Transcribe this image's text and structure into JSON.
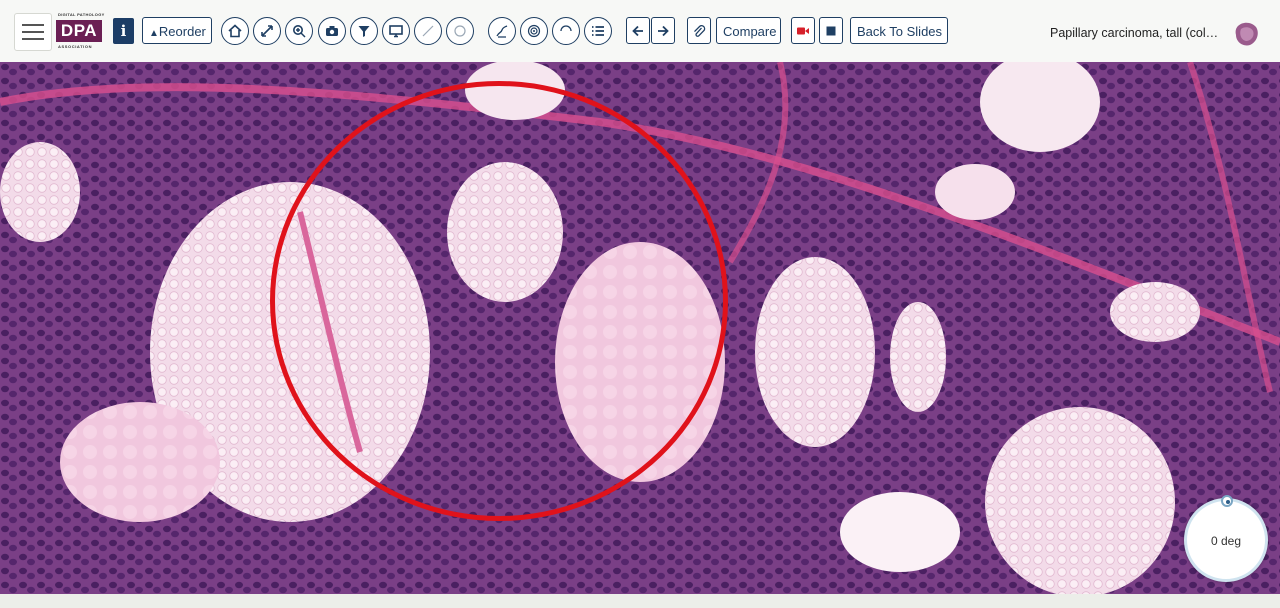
{
  "logo": {
    "line1": "DIGITAL PATHOLOGY",
    "main": "DPA",
    "line2": "ASSOCIATION"
  },
  "toolbar": {
    "info_label": "i",
    "reorder_label": "Reorder",
    "compare_label": "Compare",
    "back_label": "Back To Slides"
  },
  "icons": [
    "menu-icon",
    "info-icon",
    "home-icon",
    "fullscreen-icon",
    "zoom-icon",
    "camera-icon",
    "filter-icon",
    "monitor-icon",
    "line-icon",
    "circle-icon",
    "draw-icon",
    "spiral-icon",
    "eraser-icon",
    "list-icon",
    "arrow-left-icon",
    "arrow-right-icon",
    "paperclip-icon",
    "record-icon",
    "stop-icon"
  ],
  "slide": {
    "title": "Papillary carcinoma, tall (columnar cell variant)"
  },
  "rotation": {
    "label": "0 deg"
  },
  "colors": {
    "accent": "#1f3f63",
    "brand": "#6b1f54",
    "annotation": "#e0121b",
    "record": "#d6202a"
  }
}
